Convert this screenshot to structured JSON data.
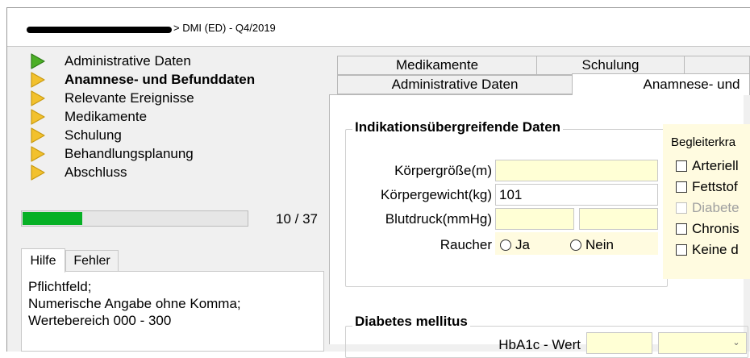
{
  "window": {
    "title": "> DMI (ED) - Q4/2019"
  },
  "nav": {
    "items": [
      {
        "label": "Administrative Daten",
        "state": "done"
      },
      {
        "label": "Anamnese- und Befunddaten",
        "state": "current"
      },
      {
        "label": "Relevante Ereignisse",
        "state": "pending"
      },
      {
        "label": "Medikamente",
        "state": "pending"
      },
      {
        "label": "Schulung",
        "state": "pending"
      },
      {
        "label": "Behandlungsplanung",
        "state": "pending"
      },
      {
        "label": "Abschluss",
        "state": "pending"
      }
    ],
    "progress": {
      "current": 10,
      "total": 37,
      "fraction": 0.27,
      "text": "10 / 37"
    }
  },
  "help": {
    "tabs": [
      "Hilfe",
      "Fehler"
    ],
    "lines": [
      "Pflichtfeld;",
      "Numerische Angabe ohne Komma;",
      "Wertebereich 000 - 300"
    ]
  },
  "tabs": {
    "row1": [
      "Medikamente",
      "Schulung",
      ""
    ],
    "row2": [
      "Administrative Daten",
      "Anamnese- und"
    ]
  },
  "form": {
    "group1_title": "Indikationsübergreifende Daten",
    "height_label": "Körpergröße(m)",
    "height_value": "",
    "weight_label": "Körpergewicht(kg)",
    "weight_value": "101",
    "bp_label": "Blutdruck(mmHg)",
    "bp_sys": "",
    "bp_dia": "",
    "smoker_label": "Raucher",
    "smoker_yes": "Ja",
    "smoker_no": "Nein",
    "group2_title": "Diabetes mellitus",
    "hba1c_label": "HbA1c - Wert"
  },
  "comorbid": {
    "title": "Begleiterkra",
    "items": [
      {
        "label": "Arteriell",
        "disabled": false
      },
      {
        "label": "Fettstof",
        "disabled": false
      },
      {
        "label": "Diabete",
        "disabled": true
      },
      {
        "label": "Chronis",
        "disabled": false
      },
      {
        "label": "Keine d",
        "disabled": false
      }
    ]
  },
  "colors": {
    "arrow_done": "#4caf26",
    "arrow_pending": "#f2c12e",
    "progress_fill": "#06b025",
    "input_required_bg": "#ffffd5"
  }
}
